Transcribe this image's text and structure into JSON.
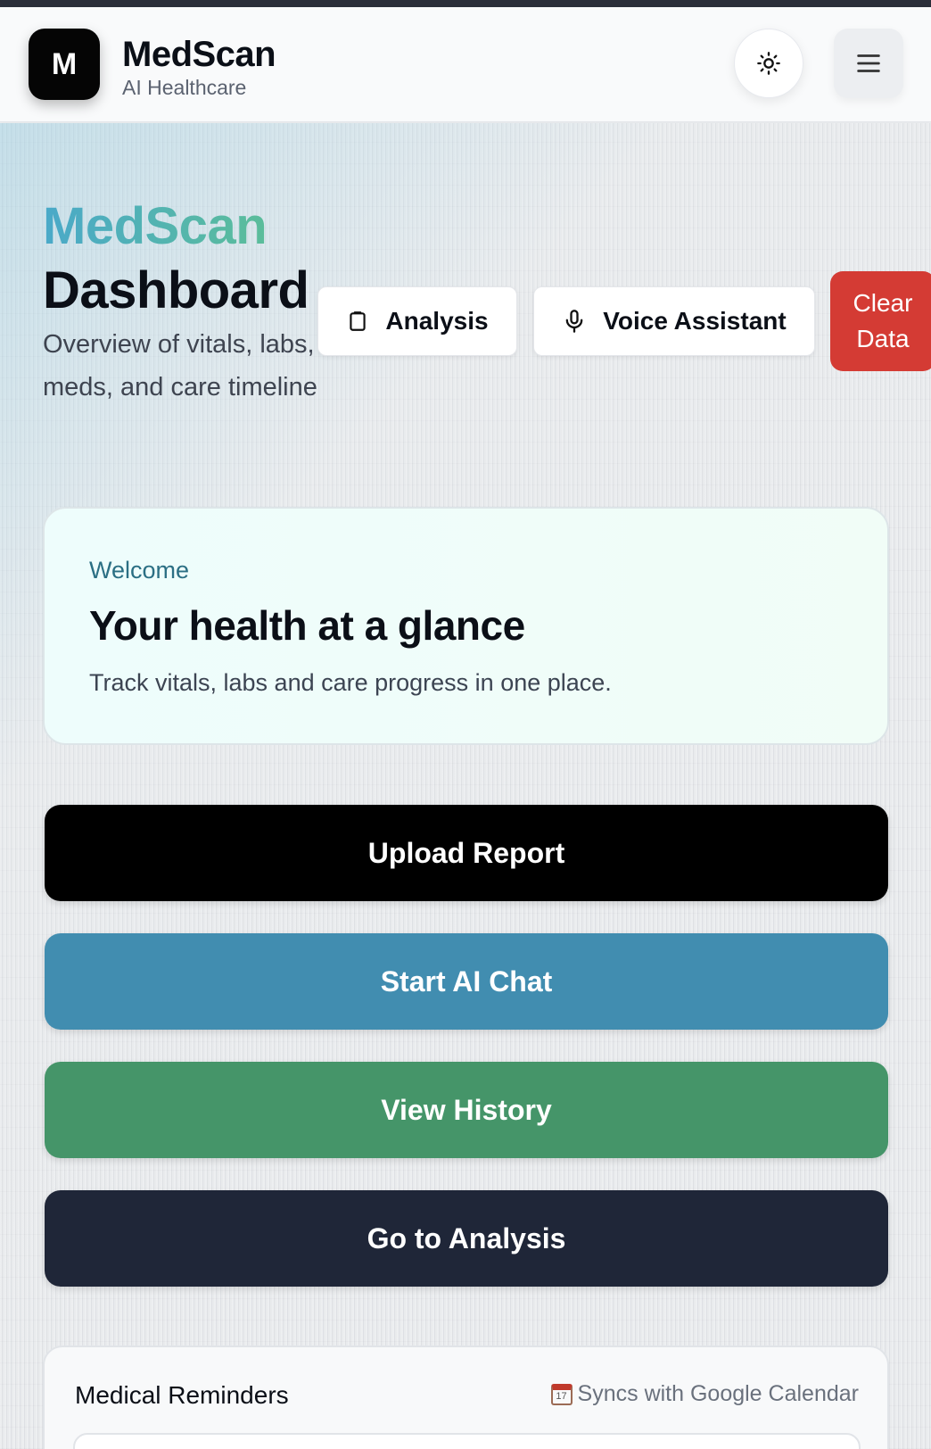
{
  "header": {
    "logo_letter": "M",
    "brand_name": "MedScan",
    "brand_subtitle": "AI Healthcare"
  },
  "hero": {
    "title_accent": "MedScan",
    "title_main": "Dashboard",
    "description": "Overview of vitals, labs, meds, and care timeline"
  },
  "toolbar": {
    "analysis_label": "Analysis",
    "voice_label": "Voice Assistant",
    "clear_label": "Clear Data"
  },
  "welcome": {
    "kicker": "Welcome",
    "title": "Your health at a glance",
    "text": "Track vitals, labs and care progress in one place."
  },
  "actions": [
    {
      "label": "Upload Report",
      "color": "#000000"
    },
    {
      "label": "Start AI Chat",
      "color": "#418db0"
    },
    {
      "label": "View History",
      "color": "#459569"
    },
    {
      "label": "Go to Analysis",
      "color": "#1f2638"
    }
  ],
  "reminders": {
    "title": "Medical Reminders",
    "sync_text": "Syncs with Google Calendar",
    "sync_icon": "calendar-icon"
  },
  "colors": {
    "clear_button": "#d43b34",
    "accent_gradient_start": "#4aa9c9",
    "accent_gradient_end": "#5bbd9a"
  }
}
